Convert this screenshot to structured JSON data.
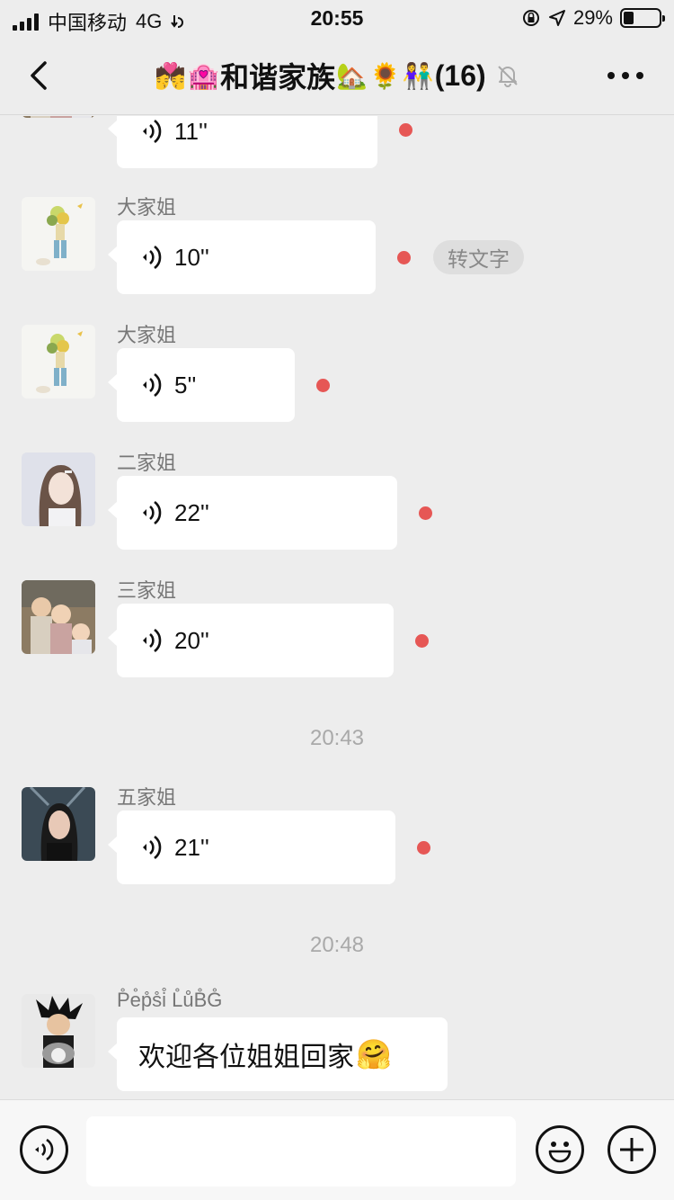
{
  "status_bar": {
    "carrier": "中国移动",
    "network": "4G",
    "time": "20:55",
    "battery_percent": "29%",
    "battery_level": 0.29
  },
  "nav": {
    "title": "和谐家族",
    "count": "(16)",
    "title_emojis": [
      "💏",
      "🏩",
      "🏡",
      "🌻",
      "👫"
    ]
  },
  "messages": [
    {
      "duration": "11''"
    },
    {
      "sender": "大家姐",
      "duration": "10''",
      "chip": "转文字"
    },
    {
      "sender": "大家姐",
      "duration": "5''"
    },
    {
      "sender": "二家姐",
      "duration": "22''"
    },
    {
      "sender": "三家姐",
      "duration": "20''"
    },
    {
      "sender": "五家姐",
      "duration": "21''"
    },
    {
      "sender": "P̊e̊p̊s̊i̊ L̊ůB̊G̊",
      "text": "欢迎各位姐姐回家",
      "emoji": "🤗"
    }
  ],
  "timestamps": [
    "20:43",
    "20:48"
  ],
  "colors": {
    "background": "#ededed",
    "bubble": "#ffffff",
    "unread_dot": "#e65755"
  }
}
